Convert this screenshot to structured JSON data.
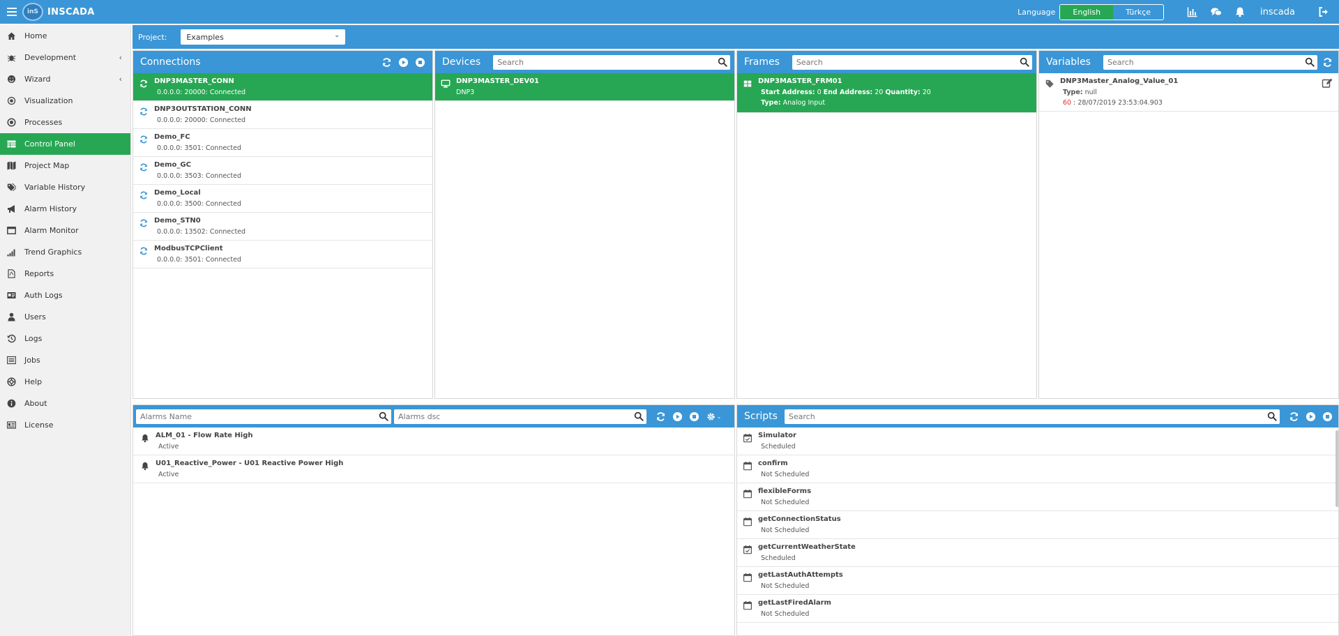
{
  "app": {
    "title": "INSCADA",
    "logo_text": "inS",
    "user": "inscada"
  },
  "language": {
    "label": "Language",
    "options": [
      {
        "label": "English",
        "active": true
      },
      {
        "label": "Türkçe",
        "active": false
      }
    ]
  },
  "sidebar": {
    "items": [
      {
        "label": "Home",
        "icon": "home-icon"
      },
      {
        "label": "Development",
        "icon": "bug-icon",
        "caret": "‹"
      },
      {
        "label": "Wizard",
        "icon": "wizard-icon",
        "caret": "‹"
      },
      {
        "label": "Visualization",
        "icon": "eye-icon"
      },
      {
        "label": "Processes",
        "icon": "process-icon"
      },
      {
        "label": "Control Panel",
        "icon": "table-icon",
        "active": true
      },
      {
        "label": "Project Map",
        "icon": "map-icon"
      },
      {
        "label": "Variable History",
        "icon": "tags-icon"
      },
      {
        "label": "Alarm History",
        "icon": "bullhorn-icon"
      },
      {
        "label": "Alarm Monitor",
        "icon": "window-icon"
      },
      {
        "label": "Trend Graphics",
        "icon": "signal-icon"
      },
      {
        "label": "Reports",
        "icon": "pdf-icon"
      },
      {
        "label": "Auth Logs",
        "icon": "id-card-icon"
      },
      {
        "label": "Users",
        "icon": "user-icon"
      },
      {
        "label": "Logs",
        "icon": "history-icon"
      },
      {
        "label": "Jobs",
        "icon": "list-icon"
      },
      {
        "label": "Help",
        "icon": "lifebuoy-icon"
      },
      {
        "label": "About",
        "icon": "info-icon"
      },
      {
        "label": "License",
        "icon": "license-icon"
      }
    ]
  },
  "project": {
    "label": "Project:",
    "value": "Examples"
  },
  "connections": {
    "title": "Connections",
    "items": [
      {
        "name": "DNP3MASTER_CONN",
        "address": "0.0.0.0: 20000: Connected",
        "selected": true
      },
      {
        "name": "DNP3OUTSTATION_CONN",
        "address": "0.0.0.0: 20000: Connected"
      },
      {
        "name": "Demo_FC",
        "address": "0.0.0.0: 3501: Connected"
      },
      {
        "name": "Demo_GC",
        "address": "0.0.0.0: 3503: Connected"
      },
      {
        "name": "Demo_Local",
        "address": "0.0.0.0: 3500: Connected"
      },
      {
        "name": "Demo_STN0",
        "address": "0.0.0.0: 13502: Connected"
      },
      {
        "name": "ModbusTCPClient",
        "address": "0.0.0.0: 3501: Connected"
      }
    ]
  },
  "devices": {
    "title": "Devices",
    "search_placeholder": "Search",
    "items": [
      {
        "name": "DNP3MASTER_DEV01",
        "protocol": "DNP3",
        "selected": true
      }
    ]
  },
  "frames": {
    "title": "Frames",
    "search_placeholder": "Search",
    "items": [
      {
        "name": "DNP3MASTER_FRM01",
        "start_label": "Start Address:",
        "start": "0",
        "end_label": "End Address:",
        "end": "20",
        "qty_label": "Quantity:",
        "qty": "20",
        "type_label": "Type:",
        "type": "Analog Input",
        "selected": true
      }
    ]
  },
  "variables": {
    "title": "Variables",
    "search_placeholder": "Search",
    "items": [
      {
        "name": "DNP3Master_Analog_Value_01",
        "type_label": "Type:",
        "type": "null",
        "value": "60",
        "sep": " : ",
        "timestamp": "28/07/2019 23:53:04.903"
      }
    ]
  },
  "alarms": {
    "name_placeholder": "Alarms Name",
    "dsc_placeholder": "Alarms dsc",
    "items": [
      {
        "name": "ALM_01 - Flow Rate High",
        "status": "Active"
      },
      {
        "name": "U01_Reactive_Power - U01 Reactive Power High",
        "status": "Active"
      }
    ]
  },
  "scripts": {
    "title": "Scripts",
    "search_placeholder": "Search",
    "items": [
      {
        "name": "Simulator",
        "status": "Scheduled",
        "scheduled": true
      },
      {
        "name": "confirm",
        "status": "Not Scheduled"
      },
      {
        "name": "flexibleForms",
        "status": "Not Scheduled"
      },
      {
        "name": "getConnectionStatus",
        "status": "Not Scheduled"
      },
      {
        "name": "getCurrentWeatherState",
        "status": "Scheduled",
        "scheduled": true
      },
      {
        "name": "getLastAuthAttempts",
        "status": "Not Scheduled"
      },
      {
        "name": "getLastFiredAlarm",
        "status": "Not Scheduled"
      }
    ]
  },
  "colors": {
    "primary": "#3a96d6",
    "active": "#27a753",
    "alarm_value": "#e03030"
  }
}
